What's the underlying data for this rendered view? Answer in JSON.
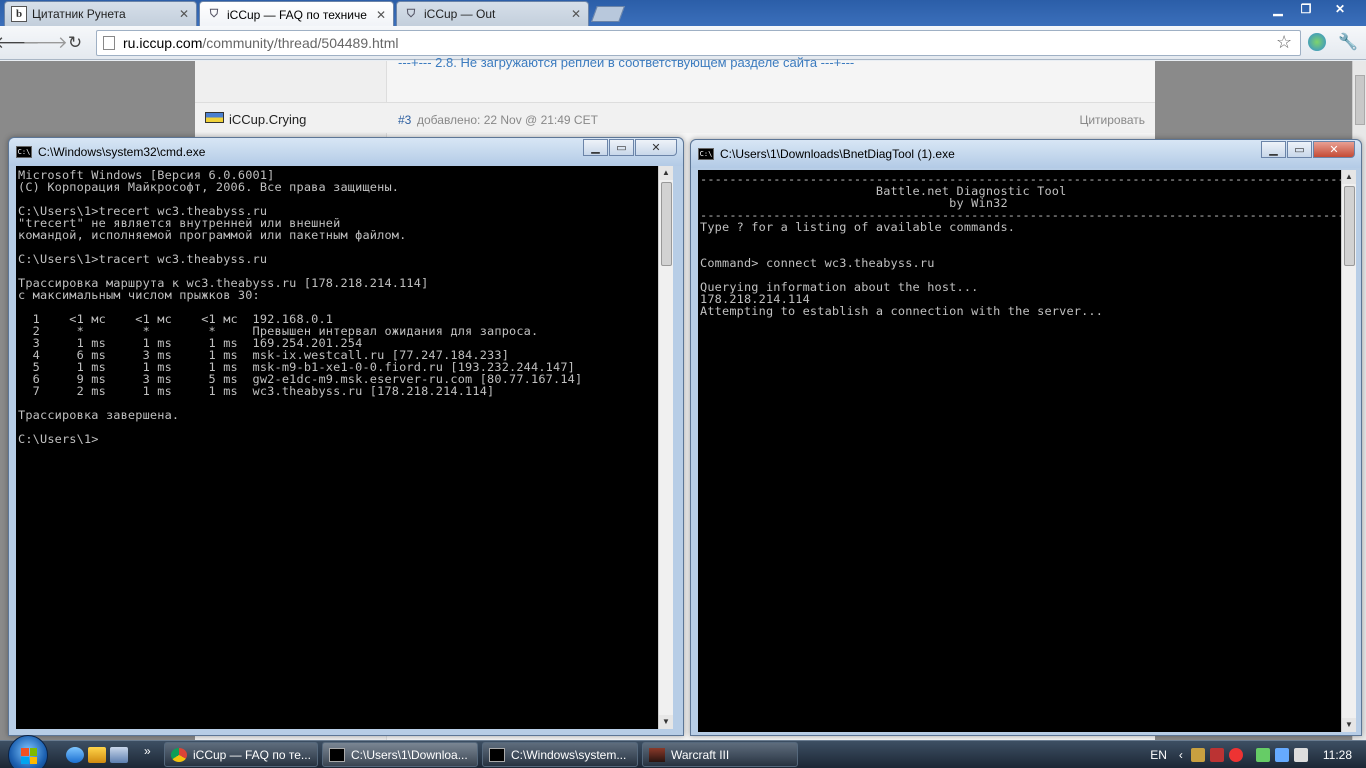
{
  "browser": {
    "tabs": [
      {
        "title": "Цитатник Рунета",
        "favicon": "b"
      },
      {
        "title": "iCCup — FAQ по техниче",
        "favicon": "shield"
      },
      {
        "title": "iCCup — Out",
        "favicon": "shield"
      }
    ],
    "url_host": "ru.iccup.com",
    "url_path": "/community/thread/504489.html",
    "window_buttons": {
      "minimize": "▁",
      "maximize": "❐",
      "close": "✕"
    }
  },
  "forum": {
    "prev_link": "---+--- 2.8. Не загружаются реплеи в соответствующем разделе сайта ---+---",
    "post_author": "iCCup.Crying",
    "post_number": "#3",
    "post_date": "добавлено: 22 Nov @ 21:49 CET",
    "quote_label": "Цитировать"
  },
  "cmd_window": {
    "title": "C:\\Windows\\system32\\cmd.exe",
    "content": "Microsoft Windows [Версия 6.0.6001]\n(C) Корпорация Майкрософт, 2006. Все права защищены.\n\nC:\\Users\\1>trecert wc3.theabyss.ru\n\"trecert\" не является внутренней или внешней\nкомандой, исполняемой программой или пакетным файлом.\n\nC:\\Users\\1>tracert wc3.theabyss.ru\n\nТрассировка маршрута к wc3.theabyss.ru [178.218.214.114]\nс максимальным числом прыжков 30:\n\n  1    <1 мс    <1 мс    <1 мс  192.168.0.1\n  2     *        *        *     Превышен интервал ожидания для запроса.\n  3     1 ms     1 ms     1 ms  169.254.201.254\n  4     6 ms     3 ms     1 ms  msk-ix.westcall.ru [77.247.184.233]\n  5     1 ms     1 ms     1 ms  msk-m9-b1-xe1-0-0.fiord.ru [193.232.244.147]\n  6     9 ms     3 ms     5 ms  gw2-e1dc-m9.msk.eserver-ru.com [80.77.167.14]\n  7     2 ms     1 ms     1 ms  wc3.theabyss.ru [178.218.214.114]\n\nТрассировка завершена.\n\nC:\\Users\\1>"
  },
  "bnet_window": {
    "title": "C:\\Users\\1\\Downloads\\BnetDiagTool (1).exe",
    "content": "--------------------------------------------------------------------------------------------\n                        Battle.net Diagnostic Tool\n                                  by Win32\n--------------------------------------------------------------------------------------------\nType ? for a listing of available commands.\n\n\nCommand> connect wc3.theabyss.ru\n\nQuerying information about the host...\n178.218.214.114\nAttempting to establish a connection with the server..."
  },
  "console_icon_text": "C:\\",
  "taskbar": {
    "quicklaunch_more": "»",
    "tasks": [
      {
        "label": "iCCup — FAQ по те..."
      },
      {
        "label": "C:\\Users\\1\\Downloa..."
      },
      {
        "label": "C:\\Windows\\system..."
      },
      {
        "label": "Warcraft III"
      }
    ],
    "language": "EN",
    "tray_chevron": "‹",
    "clock": "11:28"
  },
  "colors": {
    "console_text": "#c0c0c0",
    "console_bg": "#000000",
    "link": "#3b7bbf"
  }
}
